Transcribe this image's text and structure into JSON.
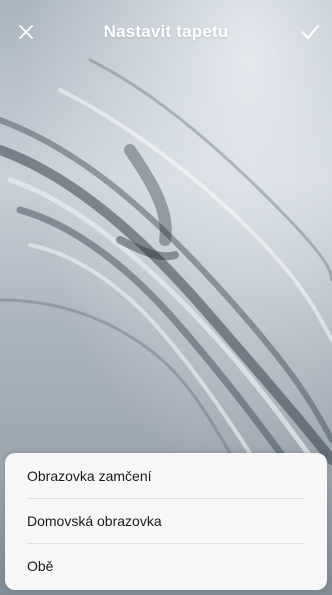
{
  "header": {
    "title": "Nastavit tapetu",
    "close_icon": "close-icon",
    "confirm_icon": "check-icon"
  },
  "wallpaper": {
    "description_icon": "wallpaper-preview",
    "base_color": "#a9b4bf"
  },
  "options": [
    {
      "label": "Obrazovka zamčení"
    },
    {
      "label": "Domovská obrazovka"
    },
    {
      "label": "Obě"
    }
  ]
}
